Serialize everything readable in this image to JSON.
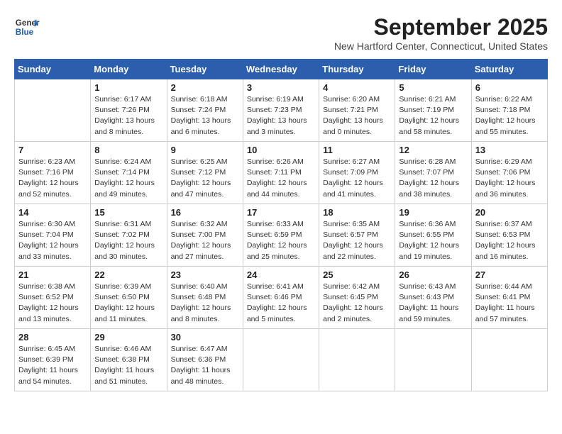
{
  "header": {
    "logo_line1": "General",
    "logo_line2": "Blue",
    "month": "September 2025",
    "location": "New Hartford Center, Connecticut, United States"
  },
  "days_of_week": [
    "Sunday",
    "Monday",
    "Tuesday",
    "Wednesday",
    "Thursday",
    "Friday",
    "Saturday"
  ],
  "weeks": [
    [
      {
        "day": "",
        "info": ""
      },
      {
        "day": "1",
        "info": "Sunrise: 6:17 AM\nSunset: 7:26 PM\nDaylight: 13 hours\nand 8 minutes."
      },
      {
        "day": "2",
        "info": "Sunrise: 6:18 AM\nSunset: 7:24 PM\nDaylight: 13 hours\nand 6 minutes."
      },
      {
        "day": "3",
        "info": "Sunrise: 6:19 AM\nSunset: 7:23 PM\nDaylight: 13 hours\nand 3 minutes."
      },
      {
        "day": "4",
        "info": "Sunrise: 6:20 AM\nSunset: 7:21 PM\nDaylight: 13 hours\nand 0 minutes."
      },
      {
        "day": "5",
        "info": "Sunrise: 6:21 AM\nSunset: 7:19 PM\nDaylight: 12 hours\nand 58 minutes."
      },
      {
        "day": "6",
        "info": "Sunrise: 6:22 AM\nSunset: 7:18 PM\nDaylight: 12 hours\nand 55 minutes."
      }
    ],
    [
      {
        "day": "7",
        "info": "Sunrise: 6:23 AM\nSunset: 7:16 PM\nDaylight: 12 hours\nand 52 minutes."
      },
      {
        "day": "8",
        "info": "Sunrise: 6:24 AM\nSunset: 7:14 PM\nDaylight: 12 hours\nand 49 minutes."
      },
      {
        "day": "9",
        "info": "Sunrise: 6:25 AM\nSunset: 7:12 PM\nDaylight: 12 hours\nand 47 minutes."
      },
      {
        "day": "10",
        "info": "Sunrise: 6:26 AM\nSunset: 7:11 PM\nDaylight: 12 hours\nand 44 minutes."
      },
      {
        "day": "11",
        "info": "Sunrise: 6:27 AM\nSunset: 7:09 PM\nDaylight: 12 hours\nand 41 minutes."
      },
      {
        "day": "12",
        "info": "Sunrise: 6:28 AM\nSunset: 7:07 PM\nDaylight: 12 hours\nand 38 minutes."
      },
      {
        "day": "13",
        "info": "Sunrise: 6:29 AM\nSunset: 7:06 PM\nDaylight: 12 hours\nand 36 minutes."
      }
    ],
    [
      {
        "day": "14",
        "info": "Sunrise: 6:30 AM\nSunset: 7:04 PM\nDaylight: 12 hours\nand 33 minutes."
      },
      {
        "day": "15",
        "info": "Sunrise: 6:31 AM\nSunset: 7:02 PM\nDaylight: 12 hours\nand 30 minutes."
      },
      {
        "day": "16",
        "info": "Sunrise: 6:32 AM\nSunset: 7:00 PM\nDaylight: 12 hours\nand 27 minutes."
      },
      {
        "day": "17",
        "info": "Sunrise: 6:33 AM\nSunset: 6:59 PM\nDaylight: 12 hours\nand 25 minutes."
      },
      {
        "day": "18",
        "info": "Sunrise: 6:35 AM\nSunset: 6:57 PM\nDaylight: 12 hours\nand 22 minutes."
      },
      {
        "day": "19",
        "info": "Sunrise: 6:36 AM\nSunset: 6:55 PM\nDaylight: 12 hours\nand 19 minutes."
      },
      {
        "day": "20",
        "info": "Sunrise: 6:37 AM\nSunset: 6:53 PM\nDaylight: 12 hours\nand 16 minutes."
      }
    ],
    [
      {
        "day": "21",
        "info": "Sunrise: 6:38 AM\nSunset: 6:52 PM\nDaylight: 12 hours\nand 13 minutes."
      },
      {
        "day": "22",
        "info": "Sunrise: 6:39 AM\nSunset: 6:50 PM\nDaylight: 12 hours\nand 11 minutes."
      },
      {
        "day": "23",
        "info": "Sunrise: 6:40 AM\nSunset: 6:48 PM\nDaylight: 12 hours\nand 8 minutes."
      },
      {
        "day": "24",
        "info": "Sunrise: 6:41 AM\nSunset: 6:46 PM\nDaylight: 12 hours\nand 5 minutes."
      },
      {
        "day": "25",
        "info": "Sunrise: 6:42 AM\nSunset: 6:45 PM\nDaylight: 12 hours\nand 2 minutes."
      },
      {
        "day": "26",
        "info": "Sunrise: 6:43 AM\nSunset: 6:43 PM\nDaylight: 11 hours\nand 59 minutes."
      },
      {
        "day": "27",
        "info": "Sunrise: 6:44 AM\nSunset: 6:41 PM\nDaylight: 11 hours\nand 57 minutes."
      }
    ],
    [
      {
        "day": "28",
        "info": "Sunrise: 6:45 AM\nSunset: 6:39 PM\nDaylight: 11 hours\nand 54 minutes."
      },
      {
        "day": "29",
        "info": "Sunrise: 6:46 AM\nSunset: 6:38 PM\nDaylight: 11 hours\nand 51 minutes."
      },
      {
        "day": "30",
        "info": "Sunrise: 6:47 AM\nSunset: 6:36 PM\nDaylight: 11 hours\nand 48 minutes."
      },
      {
        "day": "",
        "info": ""
      },
      {
        "day": "",
        "info": ""
      },
      {
        "day": "",
        "info": ""
      },
      {
        "day": "",
        "info": ""
      }
    ]
  ]
}
